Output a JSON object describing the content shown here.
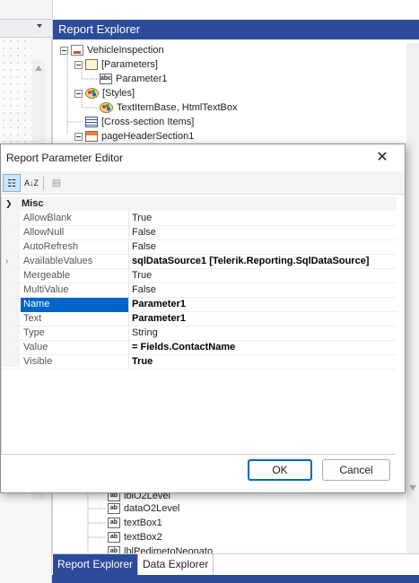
{
  "report_explorer": {
    "title": "Report Explorer",
    "tree_top": [
      {
        "label": "VehicleInspection",
        "icon": "report-icon"
      },
      {
        "label": "[Parameters]",
        "icon": "parameters-icon"
      },
      {
        "label": "Parameter1",
        "icon": "abc-icon"
      },
      {
        "label": "[Styles]",
        "icon": "styles-icon"
      },
      {
        "label": "TextItemBase, HtmlTextBox",
        "icon": "styles-icon"
      },
      {
        "label": "[Cross-section Items]",
        "icon": "cross-section-icon"
      },
      {
        "label": "pageHeaderSection1",
        "icon": "section-icon"
      }
    ],
    "tree_bottom": [
      {
        "label": "lblO2Level",
        "icon": "abc-icon"
      },
      {
        "label": "dataO2Level",
        "icon": "abc-icon"
      },
      {
        "label": "textBox1",
        "icon": "abc-icon"
      },
      {
        "label": "textBox2",
        "icon": "abc-icon"
      },
      {
        "label": "lblPedimetoNeonato",
        "icon": "abc-icon"
      }
    ],
    "tabs": [
      "Report Explorer",
      "Data Explorer"
    ]
  },
  "dialog": {
    "title": "Report Parameter Editor",
    "close_glyph": "✕",
    "toolbar": {
      "categorized_glyph": "☷",
      "alpha_glyph": "A↓Z",
      "pages_glyph": "▤"
    },
    "category": "Misc",
    "properties": [
      {
        "name": "AllowBlank",
        "value": "True",
        "bold": false,
        "expandable": false,
        "selected": false
      },
      {
        "name": "AllowNull",
        "value": "False",
        "bold": false,
        "expandable": false,
        "selected": false
      },
      {
        "name": "AutoRefresh",
        "value": "False",
        "bold": false,
        "expandable": false,
        "selected": false
      },
      {
        "name": "AvailableValues",
        "value": "sqlDataSource1 [Telerik.Reporting.SqlDataSource]",
        "bold": true,
        "expandable": true,
        "selected": false
      },
      {
        "name": "Mergeable",
        "value": "True",
        "bold": false,
        "expandable": false,
        "selected": false
      },
      {
        "name": "MultiValue",
        "value": "False",
        "bold": false,
        "expandable": false,
        "selected": false
      },
      {
        "name": "Name",
        "value": "Parameter1",
        "bold": true,
        "expandable": false,
        "selected": true
      },
      {
        "name": "Text",
        "value": "Parameter1",
        "bold": true,
        "expandable": false,
        "selected": false
      },
      {
        "name": "Type",
        "value": "String",
        "bold": false,
        "expandable": false,
        "selected": false
      },
      {
        "name": "Value",
        "value": "= Fields.ContactName",
        "bold": true,
        "expandable": false,
        "selected": false
      },
      {
        "name": "Visible",
        "value": "True",
        "bold": true,
        "expandable": false,
        "selected": false
      }
    ],
    "ok_label": "OK",
    "cancel_label": "Cancel"
  },
  "colors": {
    "accent": "#2d4b9a",
    "selection": "#0064c8"
  }
}
